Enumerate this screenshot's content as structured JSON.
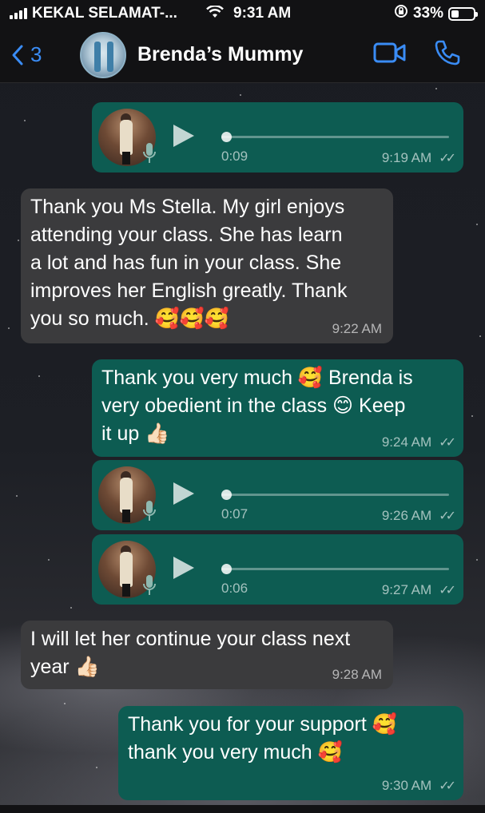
{
  "status_bar": {
    "carrier": "KEKAL SELAMAT-...",
    "time": "9:31 AM",
    "battery": "33%",
    "battery_level": 0.33
  },
  "header": {
    "back_count": "3",
    "contact_name": "Brenda’s Mummy",
    "icons": [
      "back-chevron-icon",
      "video-call-icon",
      "phone-call-icon"
    ]
  },
  "messages": [
    {
      "type": "voice",
      "direction": "outgoing",
      "duration": "0:09",
      "time": "9:19 AM",
      "read": true
    },
    {
      "type": "text",
      "direction": "incoming",
      "lines": [
        "Thank you Ms Stella. My girl enjoys",
        "attending your class. She has learn",
        "a lot and has fun in your class. She",
        "improves her English greatly. Thank",
        "you so much. 🥰🥰🥰"
      ],
      "time": "9:22 AM"
    },
    {
      "type": "text",
      "direction": "outgoing",
      "lines": [
        "Thank you very much 🥰 Brenda is",
        "very obedient in the class 😊 Keep",
        "it up 👍🏻"
      ],
      "time": "9:24 AM",
      "read": true
    },
    {
      "type": "voice",
      "direction": "outgoing",
      "duration": "0:07",
      "time": "9:26 AM",
      "read": true
    },
    {
      "type": "voice",
      "direction": "outgoing",
      "duration": "0:06",
      "time": "9:27 AM",
      "read": true
    },
    {
      "type": "text",
      "direction": "incoming",
      "lines": [
        "I will let her continue your class next",
        "year 👍🏻"
      ],
      "time": "9:28 AM"
    },
    {
      "type": "text",
      "direction": "outgoing",
      "lines": [
        "Thank you for your support 🥰",
        "thank you very much 🥰"
      ],
      "time": "9:30 AM",
      "read": true
    }
  ],
  "colors": {
    "outgoing_bubble": "#0d5c52",
    "incoming_bubble": "#3b3b3d",
    "accent": "#3a8cf5"
  }
}
